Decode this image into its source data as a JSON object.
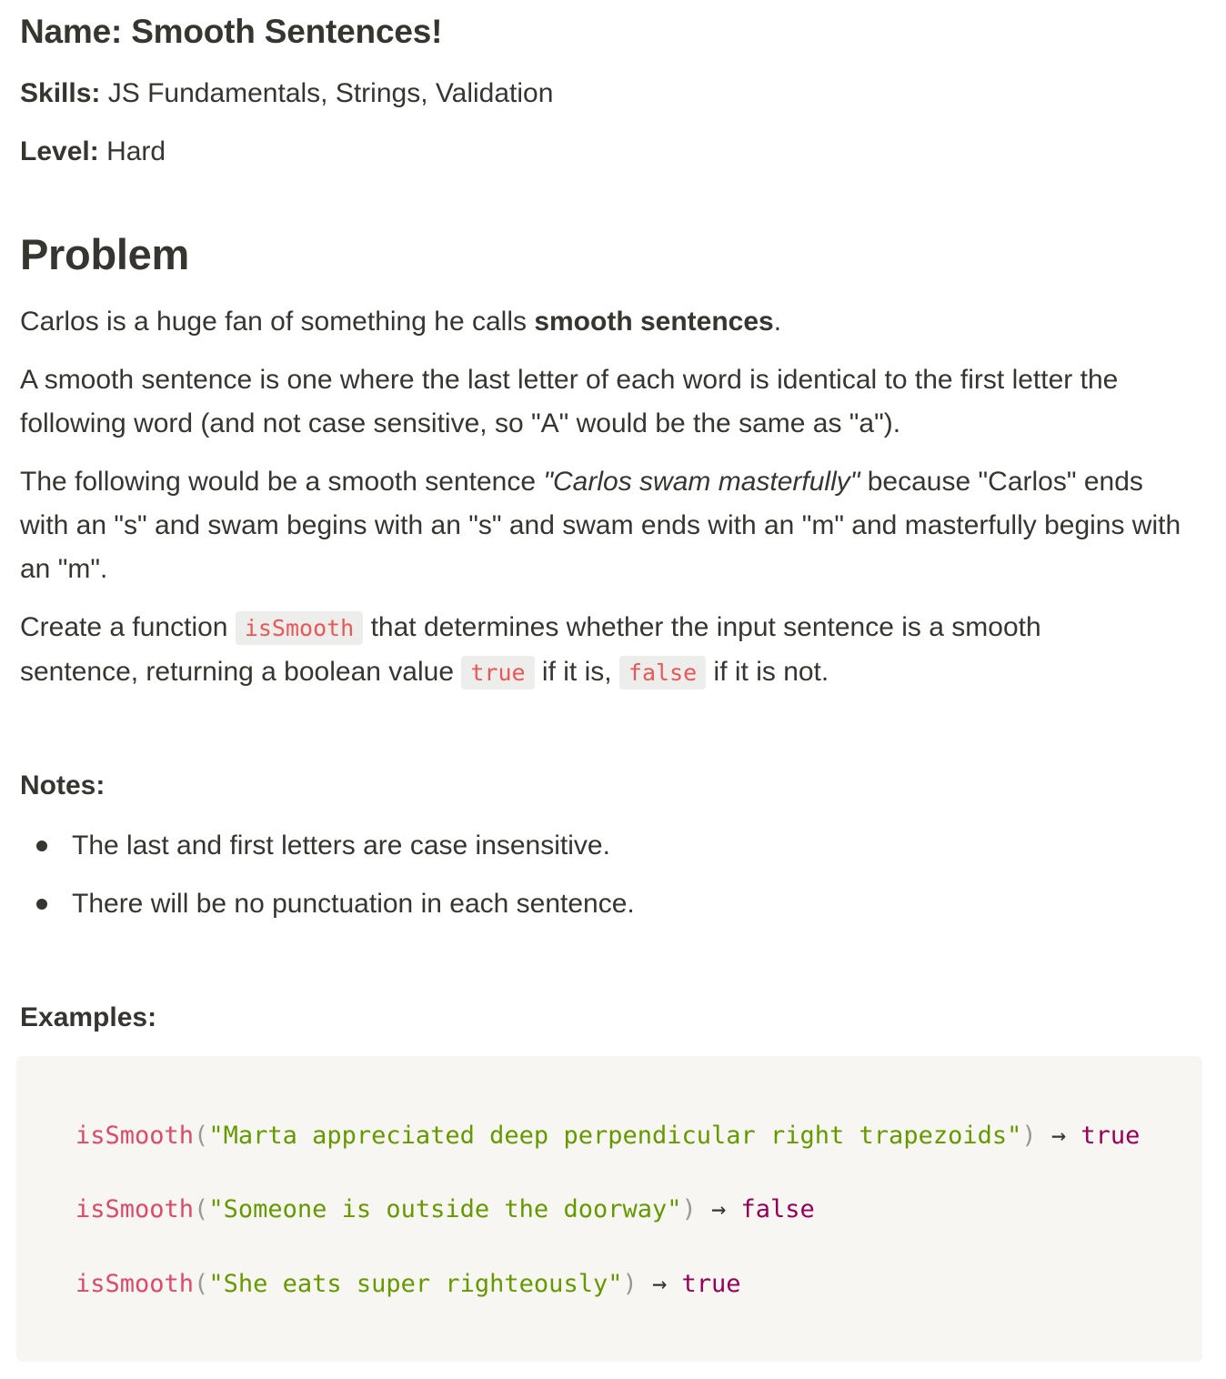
{
  "meta": {
    "name_label": "Name:",
    "name_value": "Smooth Sentences!",
    "skills_label": "Skills:",
    "skills_value": "JS Fundamentals, Strings, Validation",
    "level_label": "Level:",
    "level_value": "Hard"
  },
  "problem": {
    "heading": "Problem",
    "p1": {
      "before": "Carlos is a huge fan of something he calls ",
      "bold": "smooth sentences",
      "after": "."
    },
    "p2": "A smooth sentence is one where the last letter of each word is identical to the first letter the following word (and not case sensitive, so \"A\" would be the same as \"a\").",
    "p3": {
      "before": "The following would be a smooth sentence ",
      "italic": "\"Carlos swam masterfully\"",
      "after": " because \"Carlos\" ends with an \"s\" and swam begins with an \"s\" and swam ends with an \"m\" and masterfully begins with an \"m\"."
    },
    "p4": {
      "t1": "Create a function ",
      "code1": "isSmooth",
      "t2": " that determines whether the input sentence is a smooth sentence, returning a boolean value ",
      "code2": "true",
      "t3": " if it is, ",
      "code3": "false",
      "t4": " if it is not."
    }
  },
  "notes": {
    "heading": "Notes:",
    "items": [
      "The last and first letters are case insensitive.",
      "There will be no punctuation in each sentence."
    ]
  },
  "examples": {
    "heading": "Examples:",
    "lines": [
      {
        "fn": "isSmooth",
        "open": "(",
        "arg": "\"Marta appreciated deep perpendicular right trapezoids\"",
        "close": ")",
        "arrow": " → ",
        "result": "true"
      },
      {
        "fn": "isSmooth",
        "open": "(",
        "arg": "\"Someone is outside the doorway\"",
        "close": ")",
        "arrow": " → ",
        "result": "false"
      },
      {
        "fn": "isSmooth",
        "open": "(",
        "arg": "\"She eats super righteously\"",
        "close": ")",
        "arrow": " → ",
        "result": "true"
      }
    ]
  }
}
